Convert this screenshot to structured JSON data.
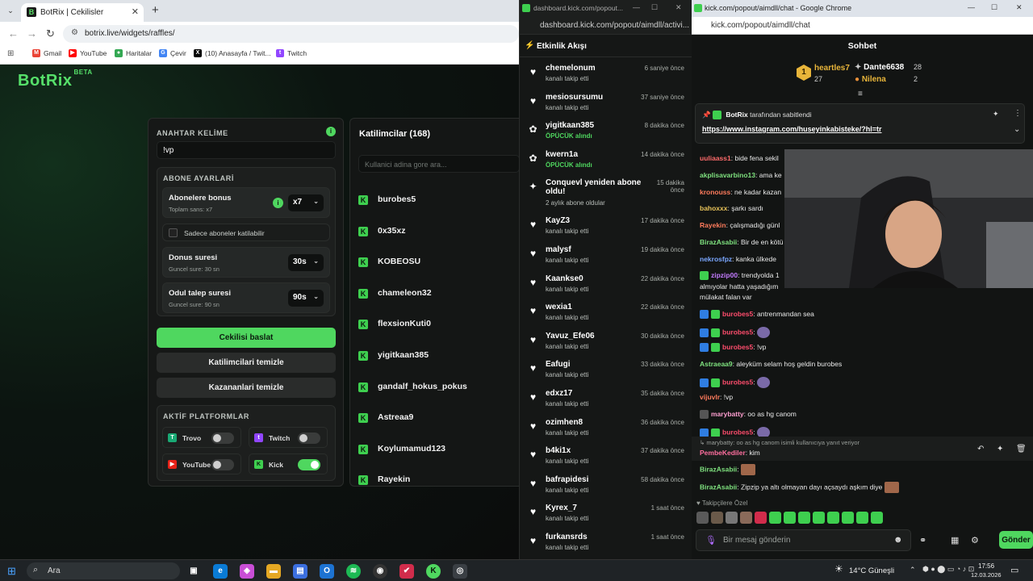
{
  "left_window": {
    "tab_title": "BotRix | Cekilisler",
    "url": "botrix.live/widgets/raffles/",
    "bookmarks": [
      "Gmail",
      "YouTube",
      "Haritalar",
      "Çevir",
      "(10) Anasayfa / Twit...",
      "Twitch"
    ],
    "logo": "BotRix",
    "logo_badge": "BETA",
    "keyword_label": "ANAHTAR KELİME",
    "keyword_value": "!vp",
    "sub_settings_label": "ABONE AYARLARİ",
    "sub_bonus_title": "Abonelere bonus",
    "sub_bonus_sub": "Toplam sans: x7",
    "sub_bonus_value": "x7",
    "sub_only_label": "Sadece aboneler katilabilir",
    "bonus_time_title": "Donus suresi",
    "bonus_time_sub": "Guncel sure: 30 sn",
    "bonus_time_value": "30s",
    "claim_time_title": "Odul talep suresi",
    "claim_time_sub": "Guncel sure: 90 sn",
    "claim_time_value": "90s",
    "start_button": "Cekilisi baslat",
    "clear_participants": "Katilimcilari temizle",
    "clear_winners": "Kazananlari temizle",
    "platforms_label": "AKTİF PLATFORMLAR",
    "platforms": [
      {
        "name": "Trovo",
        "on": false,
        "color": "#19a974",
        "glyph": "T"
      },
      {
        "name": "Twitch",
        "on": false,
        "color": "#9146ff",
        "glyph": "t"
      },
      {
        "name": "YouTube",
        "on": false,
        "color": "#e62117",
        "glyph": "▶"
      },
      {
        "name": "Kick",
        "on": true,
        "color": "#3ecf4f",
        "glyph": "K"
      }
    ],
    "participants_title": "Katilimcilar (168)",
    "participants_search_placeholder": "Kullanici adina gore ara...",
    "participants": [
      "burobes5",
      "0x35xz",
      "KOBEOSU",
      "chameleon32",
      "flexsionKuti0",
      "yigitkaan385",
      "gandalf_hokus_pokus",
      "Astreaa9",
      "Koylumamud123",
      "Rayekin"
    ]
  },
  "middle_window": {
    "title": "dashboard.kick.com/popout...",
    "url": "dashboard.kick.com/popout/aimdll/activi...",
    "header": "Etkinlik Akışı",
    "events": [
      {
        "name": "chemelonum",
        "desc": "kanalı takip etti",
        "time": "6 saniye önce",
        "icon": "heart",
        "green": false
      },
      {
        "name": "mesiosursumu",
        "desc": "kanalı takip etti",
        "time": "37 saniye önce",
        "icon": "heart",
        "green": false
      },
      {
        "name": "yigitkaan385",
        "desc": "ÖPÜCÜK alındı",
        "time": "8 dakika önce",
        "icon": "gift",
        "green": true
      },
      {
        "name": "kwern1a",
        "desc": "ÖPÜCÜK alındı",
        "time": "14 dakika önce",
        "icon": "gift",
        "green": true
      },
      {
        "name": "Conquevl yeniden abone oldu!",
        "desc": "2 aylık abone oldular",
        "time": "15 dakika önce",
        "icon": "star",
        "green": false
      },
      {
        "name": "KayZ3",
        "desc": "kanalı takip etti",
        "time": "17 dakika önce",
        "icon": "heart",
        "green": false
      },
      {
        "name": "malysf",
        "desc": "kanalı takip etti",
        "time": "19 dakika önce",
        "icon": "heart",
        "green": false
      },
      {
        "name": "Kaankse0",
        "desc": "kanalı takip etti",
        "time": "22 dakika önce",
        "icon": "heart",
        "green": false
      },
      {
        "name": "wexia1",
        "desc": "kanalı takip etti",
        "time": "22 dakika önce",
        "icon": "heart",
        "green": false
      },
      {
        "name": "Yavuz_Efe06",
        "desc": "kanalı takip etti",
        "time": "30 dakika önce",
        "icon": "heart",
        "green": false
      },
      {
        "name": "Eafugi",
        "desc": "kanalı takip etti",
        "time": "33 dakika önce",
        "icon": "heart",
        "green": false
      },
      {
        "name": "edxz17",
        "desc": "kanalı takip etti",
        "time": "35 dakika önce",
        "icon": "heart",
        "green": false
      },
      {
        "name": "ozimhen8",
        "desc": "kanalı takip etti",
        "time": "36 dakika önce",
        "icon": "heart",
        "green": false
      },
      {
        "name": "b4ki1x",
        "desc": "kanalı takip etti",
        "time": "37 dakika önce",
        "icon": "heart",
        "green": false
      },
      {
        "name": "bafrapidesi",
        "desc": "kanalı takip etti",
        "time": "58 dakika önce",
        "icon": "heart",
        "green": false
      },
      {
        "name": "Kyrex_7",
        "desc": "kanalı takip etti",
        "time": "1 saat önce",
        "icon": "heart",
        "green": false
      },
      {
        "name": "furkansrds",
        "desc": "kanalı takip etti",
        "time": "1 saat önce",
        "icon": "heart",
        "green": false
      }
    ]
  },
  "right_window": {
    "title": "kick.com/popout/aimdll/chat - Google Chrome",
    "url": "kick.com/popout/aimdll/chat",
    "header": "Sohbet",
    "leaders": [
      {
        "rank": "1",
        "name": "heartles7",
        "count": "27"
      },
      {
        "rank": "",
        "name": "Dante6638",
        "count": "28"
      },
      {
        "rank": "",
        "name": "Nilena",
        "count": "2"
      }
    ],
    "pinned_by": "BotRix",
    "pinned_by_suffix": "tarafından sabitlendi",
    "pinned_link": "https://www.instagram.com/huseyinkabisteke/?hl=tr",
    "messages": [
      {
        "user": "uuliaass1",
        "color": "#ff6b6b",
        "text": "bide fena sekil"
      },
      {
        "user": "akplisavarbino13",
        "color": "#7ee07e",
        "text": "ama ke"
      },
      {
        "user": "kronouss",
        "color": "#ff7b5c",
        "text": "ne kadar kazan"
      },
      {
        "user": "bahoxxx",
        "color": "#e8c35a",
        "text": "şarkı sardı"
      },
      {
        "user": "Rayekin",
        "color": "#ff7b5c",
        "text": "çalışmadığı günl"
      },
      {
        "user": "BirazAsabii",
        "color": "#7ee07e",
        "text": "Bir de en kötü"
      },
      {
        "user": "nekrosfpz",
        "color": "#7aa7ff",
        "text": "kanka ülkede"
      },
      {
        "user": "zipzip00",
        "color": "#c37bff",
        "text": "trendyolda 1"
      },
      {
        "user": "",
        "color": "#eaeaea",
        "text": "almıyolar hatta yaşadığım"
      },
      {
        "user": "",
        "color": "#eaeaea",
        "text": "mülakat falan var"
      },
      {
        "user": "burobes5",
        "color": "#ff4d6d",
        "text": "antrenmandan sea"
      },
      {
        "user": "burobes5",
        "color": "#ff4d6d",
        "text": ""
      },
      {
        "user": "burobes5",
        "color": "#ff4d6d",
        "text": "!vp"
      },
      {
        "user": "Astraeaa9",
        "color": "#7ee07e",
        "text": "aleyküm selam hoş geldin burobes"
      },
      {
        "user": "burobes5",
        "color": "#ff4d6d",
        "text": ""
      },
      {
        "user": "vijuvlr",
        "color": "#ff7b5c",
        "text": "!vp"
      },
      {
        "user": "marybatty",
        "color": "#ff9ecf",
        "text": "oo as hg canom"
      },
      {
        "user": "burobes5",
        "color": "#ff4d6d",
        "text": ""
      }
    ],
    "reply_hint": "marybatty: oo as hg canom isimli kullanıcıya yanıt veriyor",
    "reply_user": "PembeKediler",
    "reply_text": "kim",
    "tail_messages": [
      {
        "user": "BirazAsabii",
        "text": ""
      },
      {
        "user": "BirazAsabii",
        "text": "Zipzip ya altı olmayan dayı açsaydı aşkım diye"
      }
    ],
    "followers_only": "Takipçilere Özel",
    "input_placeholder": "Bir mesaj gönderin",
    "send": "Gönder"
  },
  "taskbar": {
    "search": "Ara",
    "weather": "14°C  Güneşli",
    "time": "17:56",
    "date": "12.03.2026"
  }
}
